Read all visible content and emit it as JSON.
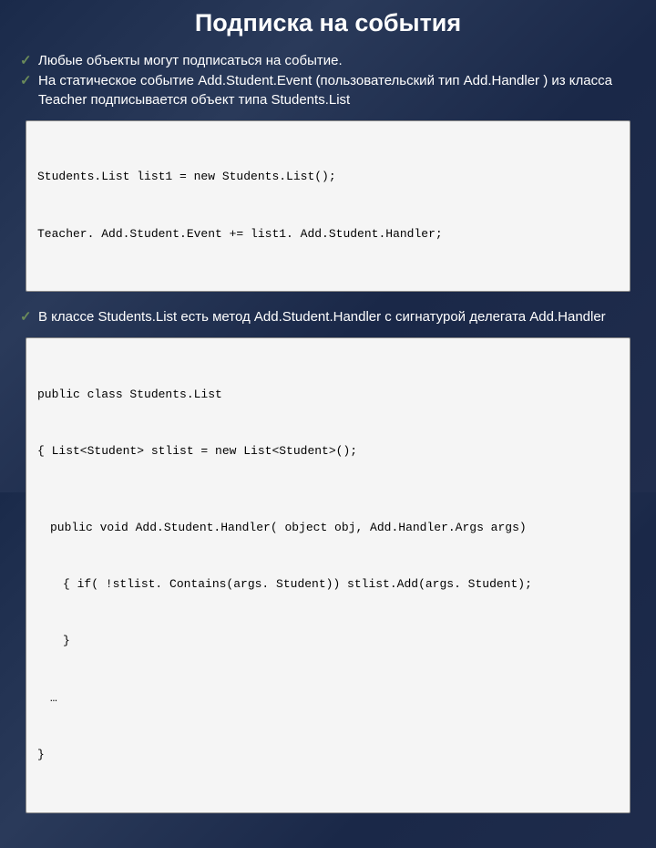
{
  "title": "Подписка на события",
  "bullets1": [
    "Любые объекты могут подписаться на событие.",
    "На статическое событие  Add.Student.Event  (пользовательский тип Add.Handler ) из класса Teacher подписывается объект типа Students.List"
  ],
  "code1": [
    "Students.List list1 = new Students.List();",
    "Teacher. Add.Student.Event += list1. Add.Student.Handler;"
  ],
  "bullets2": [
    "В классе Students.List  есть метод  Add.Student.Handler с сигнатурой делегата Add.Handler"
  ],
  "code2": [
    "public class Students.List",
    "{ List<Student> stlist = new List<Student>();",
    "public void Add.Student.Handler( object obj, Add.Handler.Args args)",
    "{ if( !stlist. Contains(args. Student)) stlist.Add(args. Student);",
    "}",
    "…",
    "}"
  ]
}
